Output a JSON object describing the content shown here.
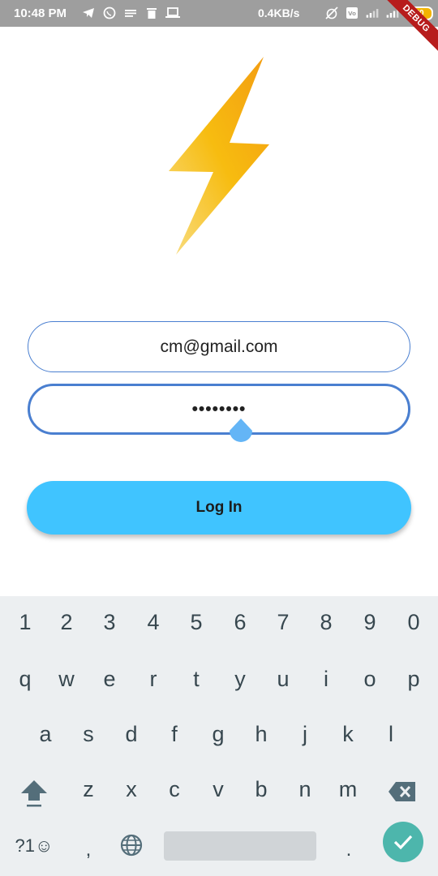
{
  "status_bar": {
    "time": "10:48 PM",
    "net_speed": "0.4KB/s",
    "battery": "80",
    "debug": "DEBUG",
    "icons_left": [
      "telegram-icon",
      "whatsapp-icon",
      "notes-icon",
      "trash-icon",
      "laptop-icon"
    ],
    "icons_right": [
      "alarm-off-icon",
      "volte-icon",
      "signal-4g-icon",
      "signal-icon",
      "battery-icon"
    ]
  },
  "form": {
    "email": "cm@gmail.com",
    "password_mask": "••••••••",
    "login_label": "Log In"
  },
  "keyboard": {
    "row_numbers": [
      "1",
      "2",
      "3",
      "4",
      "5",
      "6",
      "7",
      "8",
      "9",
      "0"
    ],
    "row1": [
      "q",
      "w",
      "e",
      "r",
      "t",
      "y",
      "u",
      "i",
      "o",
      "p"
    ],
    "row2": [
      "a",
      "s",
      "d",
      "f",
      "g",
      "h",
      "j",
      "k",
      "l"
    ],
    "row3": [
      "z",
      "x",
      "c",
      "v",
      "b",
      "n",
      "m"
    ],
    "symbols_label": "?1☺",
    "comma": ",",
    "period": "."
  },
  "colors": {
    "accent_blue": "#4a7fd0",
    "button_blue": "#40c4ff",
    "enter_teal": "#4db6ac",
    "bolt_yellow": "#f5b700",
    "statusbar_gray": "#9e9e9e"
  }
}
